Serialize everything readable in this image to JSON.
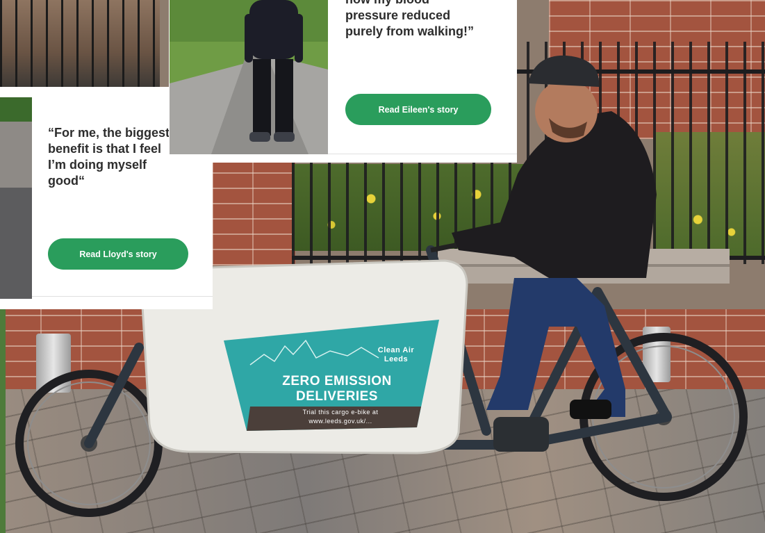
{
  "cards": [
    {
      "quote": "“For me, the biggest benefit is that I feel I’m doing myself good“",
      "button_label": "Read Lloyd's story"
    },
    {
      "quote_visible": "how my blood pressure reduced purely from walking!”",
      "button_label": "Read Eileen's story"
    }
  ],
  "bike_panel": {
    "brand": "Clean Air Leeds",
    "headline_line1": "ZERO EMISSION",
    "headline_line2": "DELIVERIES",
    "footer_line1": "Trial this cargo e-bike at",
    "footer_line2": "www.leeds.gov.uk/..."
  },
  "colors": {
    "button_green": "#2a9d5c",
    "panel_teal": "#2fa7a6",
    "quote_text": "#2d2d2d"
  }
}
